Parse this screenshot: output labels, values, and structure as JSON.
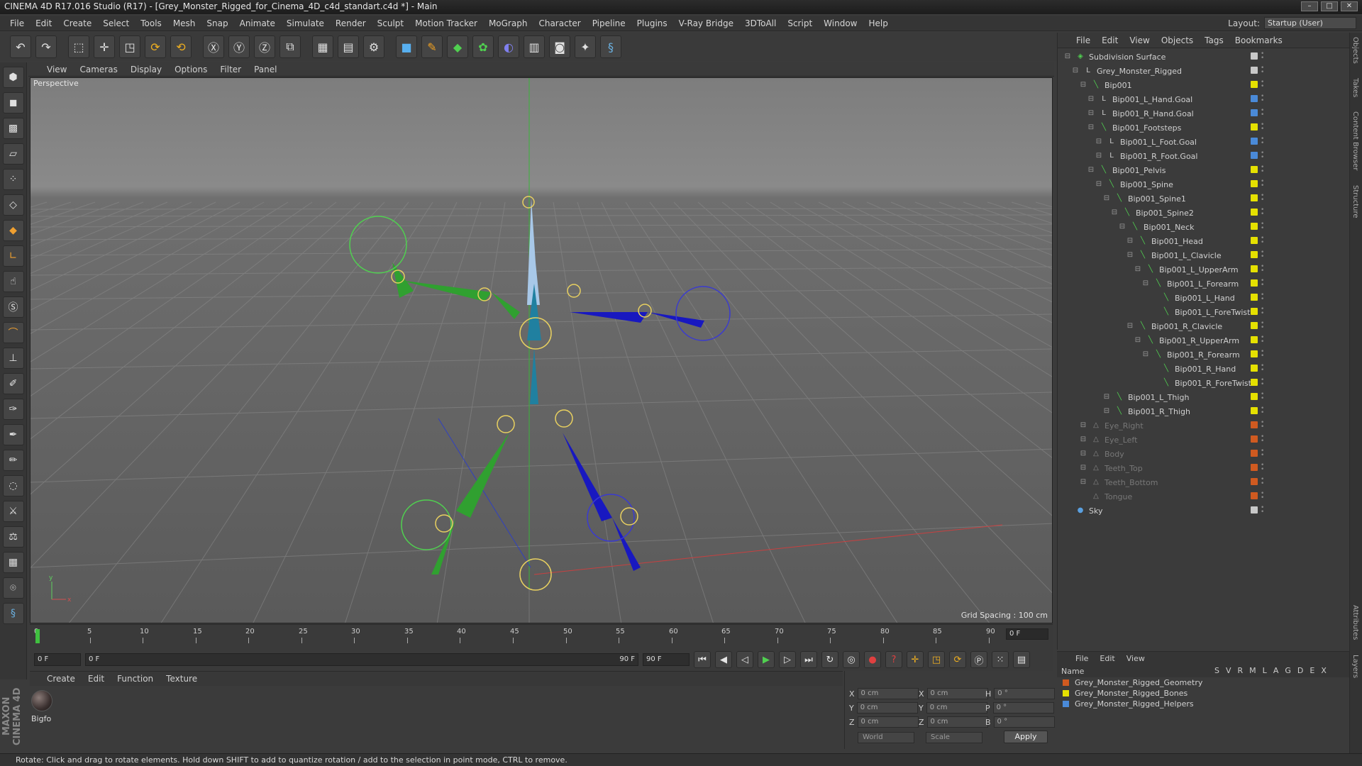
{
  "titlebar": {
    "title": "CINEMA 4D R17.016 Studio (R17) - [Grey_Monster_Rigged_for_Cinema_4D_c4d_standart.c4d *] - Main"
  },
  "menubar": {
    "items": [
      "File",
      "Edit",
      "Create",
      "Select",
      "Tools",
      "Mesh",
      "Snap",
      "Animate",
      "Simulate",
      "Render",
      "Sculpt",
      "Motion Tracker",
      "MoGraph",
      "Character",
      "Pipeline",
      "Plugins",
      "V-Ray Bridge",
      "3DToAll",
      "Script",
      "Window",
      "Help"
    ],
    "layout_label": "Layout:",
    "layout_value": "Startup (User)"
  },
  "viewport": {
    "menu": [
      "View",
      "Cameras",
      "Display",
      "Options",
      "Filter",
      "Panel"
    ],
    "label": "Perspective",
    "grid_spacing": "Grid Spacing : 100 cm"
  },
  "timeline": {
    "ticks": [
      "0",
      "5",
      "10",
      "15",
      "20",
      "25",
      "30",
      "35",
      "40",
      "45",
      "50",
      "55",
      "60",
      "65",
      "70",
      "75",
      "80",
      "85",
      "90"
    ],
    "current_frame": "0 F",
    "start": "0 F",
    "range_start": "0 F",
    "range_end": "90 F",
    "end": "90 F"
  },
  "material": {
    "menu": [
      "Create",
      "Edit",
      "Function",
      "Texture"
    ],
    "name": "Bigfo"
  },
  "coordinates": {
    "x1": "0 cm",
    "y1": "0 cm",
    "z1": "0 cm",
    "x2": "0 cm",
    "y2": "0 cm",
    "z2": "0 cm",
    "h": "0 °",
    "p": "0 °",
    "b": "0 °",
    "mode": "World",
    "scale": "Scale",
    "apply": "Apply",
    "lx": "X",
    "ly": "Y",
    "lz": "Z",
    "lx2": "X",
    "ly2": "Y",
    "lz2": "Z",
    "lh": "H",
    "lp": "P",
    "lb": "B"
  },
  "objects": {
    "menu": [
      "File",
      "Edit",
      "View",
      "Objects",
      "Tags",
      "Bookmarks"
    ],
    "rows": [
      {
        "name": "Subdivision Surface",
        "indent": 0,
        "color": "#c8c8c8",
        "dim": false,
        "icon": "subdivision-icon"
      },
      {
        "name": "Grey_Monster_Rigged",
        "indent": 1,
        "color": "#c8c8c8",
        "dim": false,
        "icon": "null-icon"
      },
      {
        "name": "Bip001",
        "indent": 2,
        "color": "#e5e000",
        "dim": false,
        "icon": "bone-icon"
      },
      {
        "name": "Bip001_L_Hand.Goal",
        "indent": 3,
        "color": "#4a8ad8",
        "dim": false,
        "icon": "null-icon"
      },
      {
        "name": "Bip001_R_Hand.Goal",
        "indent": 3,
        "color": "#4a8ad8",
        "dim": false,
        "icon": "null-icon"
      },
      {
        "name": "Bip001_Footsteps",
        "indent": 3,
        "color": "#e5e000",
        "dim": false,
        "icon": "bone-icon"
      },
      {
        "name": "Bip001_L_Foot.Goal",
        "indent": 4,
        "color": "#4a8ad8",
        "dim": false,
        "icon": "null-icon"
      },
      {
        "name": "Bip001_R_Foot.Goal",
        "indent": 4,
        "color": "#4a8ad8",
        "dim": false,
        "icon": "null-icon"
      },
      {
        "name": "Bip001_Pelvis",
        "indent": 3,
        "color": "#e5e000",
        "dim": false,
        "icon": "bone-icon"
      },
      {
        "name": "Bip001_Spine",
        "indent": 4,
        "color": "#e5e000",
        "dim": false,
        "icon": "bone-icon"
      },
      {
        "name": "Bip001_Spine1",
        "indent": 5,
        "color": "#e5e000",
        "dim": false,
        "icon": "bone-icon"
      },
      {
        "name": "Bip001_Spine2",
        "indent": 6,
        "color": "#e5e000",
        "dim": false,
        "icon": "bone-icon"
      },
      {
        "name": "Bip001_Neck",
        "indent": 7,
        "color": "#e5e000",
        "dim": false,
        "icon": "bone-icon"
      },
      {
        "name": "Bip001_Head",
        "indent": 8,
        "color": "#e5e000",
        "dim": false,
        "icon": "bone-icon"
      },
      {
        "name": "Bip001_L_Clavicle",
        "indent": 8,
        "color": "#e5e000",
        "dim": false,
        "icon": "bone-icon"
      },
      {
        "name": "Bip001_L_UpperArm",
        "indent": 9,
        "color": "#e5e000",
        "dim": false,
        "icon": "bone-icon"
      },
      {
        "name": "Bip001_L_Forearm",
        "indent": 10,
        "color": "#e5e000",
        "dim": false,
        "icon": "bone-icon"
      },
      {
        "name": "Bip001_L_Hand",
        "indent": 11,
        "color": "#e5e000",
        "dim": false,
        "icon": "bone-icon"
      },
      {
        "name": "Bip001_L_ForeTwist",
        "indent": 11,
        "color": "#e5e000",
        "dim": false,
        "icon": "bone-icon"
      },
      {
        "name": "Bip001_R_Clavicle",
        "indent": 8,
        "color": "#e5e000",
        "dim": false,
        "icon": "bone-icon"
      },
      {
        "name": "Bip001_R_UpperArm",
        "indent": 9,
        "color": "#e5e000",
        "dim": false,
        "icon": "bone-icon"
      },
      {
        "name": "Bip001_R_Forearm",
        "indent": 10,
        "color": "#e5e000",
        "dim": false,
        "icon": "bone-icon"
      },
      {
        "name": "Bip001_R_Hand",
        "indent": 11,
        "color": "#e5e000",
        "dim": false,
        "icon": "bone-icon"
      },
      {
        "name": "Bip001_R_ForeTwist",
        "indent": 11,
        "color": "#e5e000",
        "dim": false,
        "icon": "bone-icon"
      },
      {
        "name": "Bip001_L_Thigh",
        "indent": 5,
        "color": "#e5e000",
        "dim": false,
        "icon": "bone-icon"
      },
      {
        "name": "Bip001_R_Thigh",
        "indent": 5,
        "color": "#e5e000",
        "dim": false,
        "icon": "bone-icon"
      },
      {
        "name": "Eye_Right",
        "indent": 2,
        "color": "#d05a20",
        "dim": true,
        "icon": "polygon-icon"
      },
      {
        "name": "Eye_Left",
        "indent": 2,
        "color": "#d05a20",
        "dim": true,
        "icon": "polygon-icon"
      },
      {
        "name": "Body",
        "indent": 2,
        "color": "#d05a20",
        "dim": true,
        "icon": "polygon-icon"
      },
      {
        "name": "Teeth_Top",
        "indent": 2,
        "color": "#d05a20",
        "dim": true,
        "icon": "polygon-icon"
      },
      {
        "name": "Teeth_Bottom",
        "indent": 2,
        "color": "#d05a20",
        "dim": true,
        "icon": "polygon-icon"
      },
      {
        "name": "Tongue",
        "indent": 2,
        "color": "#d05a20",
        "dim": true,
        "icon": "polygon-icon"
      },
      {
        "name": "Sky",
        "indent": 0,
        "color": "#c8c8c8",
        "dim": false,
        "icon": "sky-icon"
      }
    ]
  },
  "layers": {
    "menu": [
      "File",
      "Edit",
      "View"
    ],
    "col_name": "Name",
    "cols": [
      "S",
      "V",
      "R",
      "M",
      "L",
      "A",
      "G",
      "D",
      "E",
      "X"
    ],
    "rows": [
      {
        "name": "Grey_Monster_Rigged_Geometry",
        "color": "#d05a20"
      },
      {
        "name": "Grey_Monster_Rigged_Bones",
        "color": "#e5e000"
      },
      {
        "name": "Grey_Monster_Rigged_Helpers",
        "color": "#4a8ad8"
      }
    ]
  },
  "sidebar": {
    "tabs": [
      "Objects",
      "Takes",
      "Content Browser",
      "Structure"
    ],
    "bottom_tabs": [
      "Attributes",
      "Layers"
    ]
  },
  "status": {
    "text": "Rotate: Click and drag to rotate elements. Hold down SHIFT to add to quantize rotation / add to the selection in point mode, CTRL to remove."
  },
  "brand": {
    "text": "MAXON CINEMA 4D"
  }
}
